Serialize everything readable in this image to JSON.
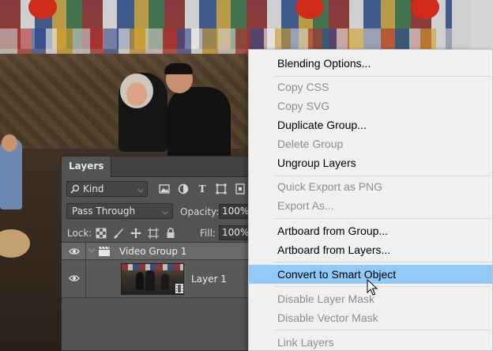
{
  "layers_panel": {
    "tab_label": "Layers",
    "filter": {
      "kind_label": "Kind"
    },
    "blend_mode": "Pass Through",
    "opacity_label": "Opacity:",
    "opacity_value": "100%",
    "lock_label": "Lock:",
    "fill_label": "Fill:",
    "fill_value": "100%",
    "layers": [
      {
        "name": "Video Group 1",
        "type": "video-group",
        "visible": true,
        "expanded": true
      },
      {
        "name": "Layer 1",
        "type": "video-layer",
        "visible": true
      }
    ]
  },
  "context_menu": {
    "items": [
      {
        "label": "Blending Options...",
        "enabled": true
      },
      {
        "label": "Copy CSS",
        "enabled": false
      },
      {
        "label": "Copy SVG",
        "enabled": false
      },
      {
        "label": "Duplicate Group...",
        "enabled": true
      },
      {
        "label": "Delete Group",
        "enabled": false
      },
      {
        "label": "Ungroup Layers",
        "enabled": true
      },
      {
        "label": "Quick Export as PNG",
        "enabled": false
      },
      {
        "label": "Export As...",
        "enabled": false
      },
      {
        "label": "Artboard from Group...",
        "enabled": true
      },
      {
        "label": "Artboard from Layers...",
        "enabled": true
      },
      {
        "label": "Convert to Smart Object",
        "enabled": true,
        "highlighted": true
      },
      {
        "label": "Disable Layer Mask",
        "enabled": false
      },
      {
        "label": "Disable Vector Mask",
        "enabled": false
      },
      {
        "label": "Link Layers",
        "enabled": false
      }
    ]
  },
  "colors": {
    "panel_bg": "#535353",
    "menu_bg": "#f0f0f0",
    "menu_highlight": "#91c9f7",
    "disabled_text": "#8d8d8d"
  }
}
